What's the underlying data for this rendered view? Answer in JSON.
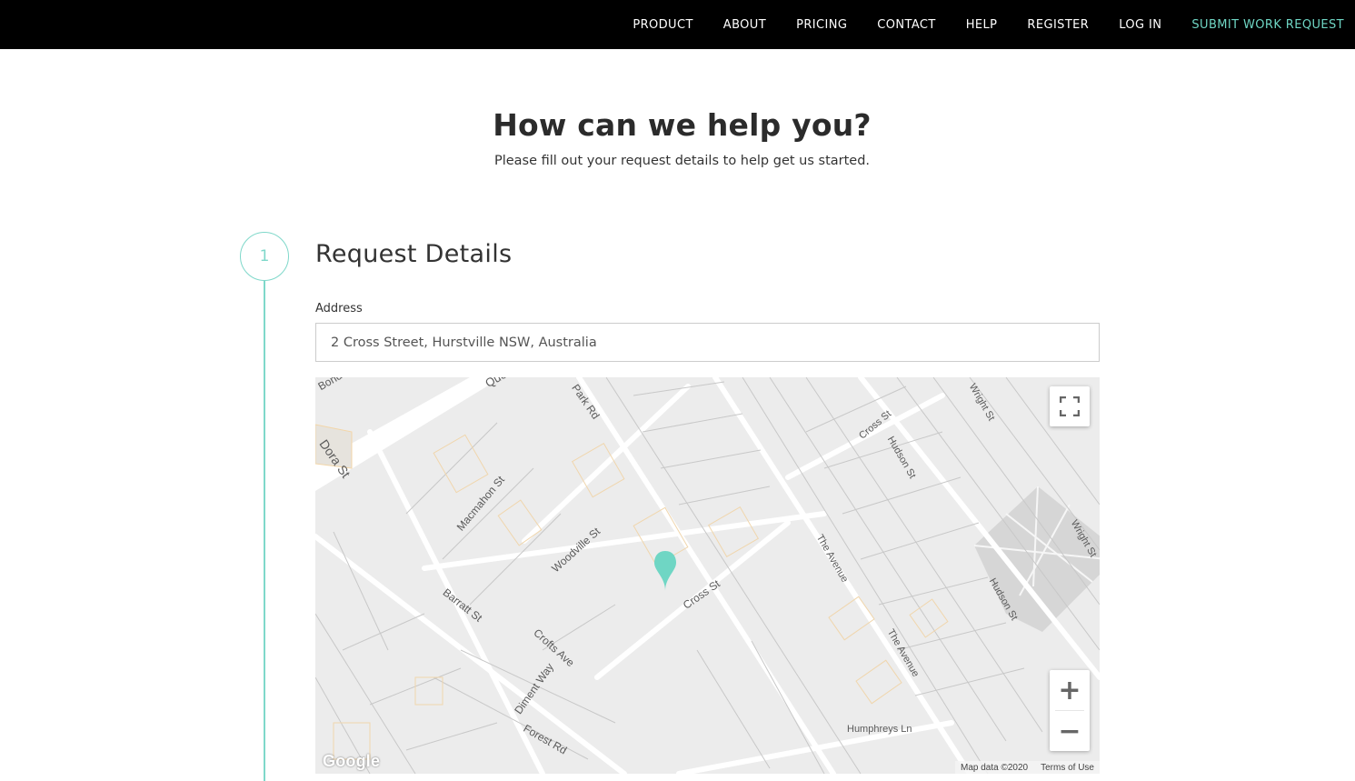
{
  "nav": {
    "items": [
      "PRODUCT",
      "ABOUT",
      "PRICING",
      "CONTACT",
      "HELP",
      "REGISTER",
      "LOG IN"
    ],
    "cta": "SUBMIT WORK REQUEST",
    "accent_color": "#6fd6c4"
  },
  "hero": {
    "title": "How can we help you?",
    "subtitle": "Please fill out your request details to help get us started."
  },
  "step": {
    "number": "1",
    "title": "Request Details",
    "accent_color": "#7fd8ca"
  },
  "address": {
    "label": "Address",
    "value": "2 Cross Street, Hurstville NSW, Australia"
  },
  "map": {
    "streets": [
      "Bond",
      "Queens Rd",
      "Dora St",
      "Park Rd",
      "Macmahon St",
      "Woodville St",
      "Barratt St",
      "Crofts Ave",
      "Diment Way",
      "Forest Rd",
      "Cross St",
      "Cross St",
      "Hudson St",
      "Hudson St",
      "Wright St",
      "Wright St",
      "The Avenue",
      "The Avenue",
      "Humphreys Ln"
    ],
    "logo": "Google",
    "map_data": "Map data ©2020",
    "terms": "Terms of Use",
    "controls": {
      "fullscreen_icon": "fullscreen-icon",
      "zoom_in": "+",
      "zoom_out": "−"
    },
    "marker_color": "#6fd6c4"
  }
}
